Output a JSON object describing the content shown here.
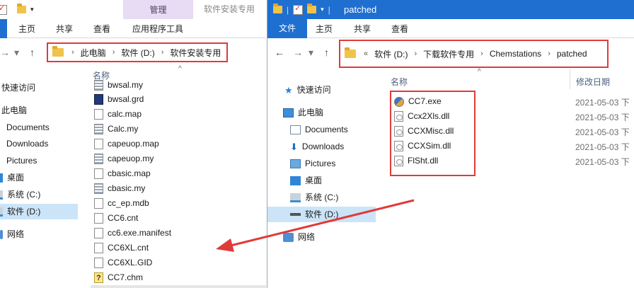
{
  "left_window": {
    "ribbon": {
      "context_group_label": "管理",
      "context_window_title": "软件安装专用",
      "tabs": [
        "主页",
        "共享",
        "查看",
        "应用程序工具"
      ]
    },
    "address": {
      "segments": [
        "此电脑",
        "软件 (D:)",
        "软件安装专用"
      ]
    },
    "column_name": "名称",
    "nav": [
      "快速访问",
      "此电脑",
      "Documents",
      "Downloads",
      "Pictures",
      "桌面",
      "系统 (C:)",
      "软件 (D:)",
      "网络"
    ],
    "files": [
      {
        "name": "bwsal.my",
        "icon": "my-icon"
      },
      {
        "name": "bwsal.grd",
        "icon": "grd-icon"
      },
      {
        "name": "calc.map",
        "icon": "file-icon"
      },
      {
        "name": "Calc.my",
        "icon": "my-icon"
      },
      {
        "name": "capeuop.map",
        "icon": "file-icon"
      },
      {
        "name": "capeuop.my",
        "icon": "my-icon"
      },
      {
        "name": "cbasic.map",
        "icon": "file-icon"
      },
      {
        "name": "cbasic.my",
        "icon": "my-icon"
      },
      {
        "name": "cc_ep.mdb",
        "icon": "file-icon"
      },
      {
        "name": "CC6.cnt",
        "icon": "file-icon"
      },
      {
        "name": "cc6.exe.manifest",
        "icon": "file-icon"
      },
      {
        "name": "CC6XL.cnt",
        "icon": "file-icon"
      },
      {
        "name": "CC6XL.GID",
        "icon": "file-icon"
      },
      {
        "name": "CC7.chm",
        "icon": "help-file-icon"
      }
    ]
  },
  "right_window": {
    "title": "patched",
    "ribbon": {
      "file_tab": "文件",
      "tabs": [
        "主页",
        "共享",
        "查看"
      ]
    },
    "address": {
      "overflow": "«",
      "segments": [
        "软件 (D:)",
        "下载软件专用",
        "Chemstations",
        "patched"
      ]
    },
    "column_name": "名称",
    "column_modified": "修改日期",
    "nav": [
      "快速访问",
      "此电脑",
      "Documents",
      "Downloads",
      "Pictures",
      "桌面",
      "系统 (C:)",
      "软件 (D:)",
      "网络"
    ],
    "files": [
      {
        "name": "CC7.exe",
        "modified": "2021-05-03 下",
        "icon": "exe-icon"
      },
      {
        "name": "Ccx2Xls.dll",
        "modified": "2021-05-03 下",
        "icon": "dll-icon"
      },
      {
        "name": "CCXMisc.dll",
        "modified": "2021-05-03 下",
        "icon": "dll-icon"
      },
      {
        "name": "CCXSim.dll",
        "modified": "2021-05-03 下",
        "icon": "dll-icon"
      },
      {
        "name": "FlSht.dll",
        "modified": "2021-05-03 下",
        "icon": "dll-icon"
      }
    ]
  },
  "colors": {
    "highlight_border": "#e03a3a",
    "arrow": "#e03a3a",
    "ribbon_blue": "#1f6fd0",
    "selection": "#cce4f7",
    "context_tab": "#e7dcf3"
  }
}
